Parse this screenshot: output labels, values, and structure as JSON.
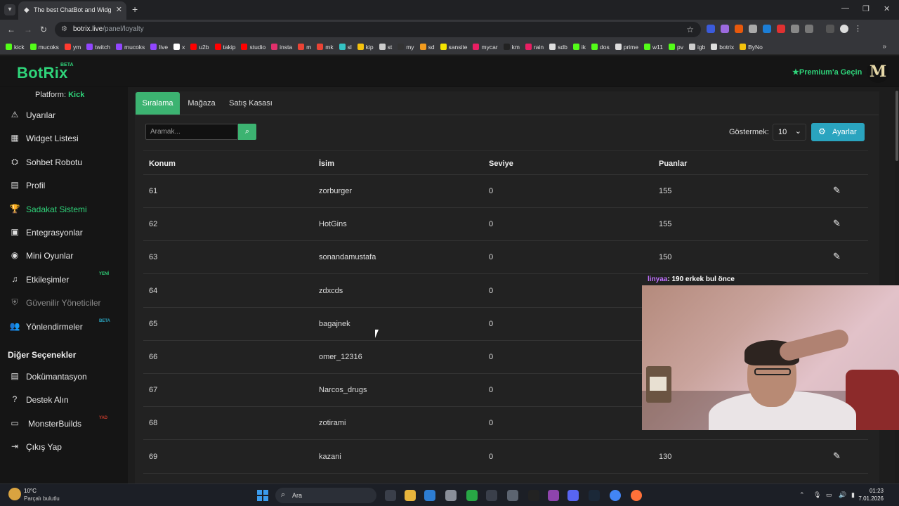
{
  "browser": {
    "tab_title": "The best ChatBot and Widgets",
    "url_host": "botrix.live",
    "url_path": "/panel/loyalty",
    "bookmarks": [
      {
        "label": "kick",
        "color": "#53fc18"
      },
      {
        "label": "mucoks",
        "color": "#53fc18"
      },
      {
        "label": "ym",
        "color": "#ff3b30"
      },
      {
        "label": "twitch",
        "color": "#9146ff"
      },
      {
        "label": "mucoks",
        "color": "#9146ff"
      },
      {
        "label": "live",
        "color": "#9146ff"
      },
      {
        "label": "x",
        "color": "#ffffff"
      },
      {
        "label": "u2b",
        "color": "#ff0000"
      },
      {
        "label": "takip",
        "color": "#ff0000"
      },
      {
        "label": "studio",
        "color": "#ff0000"
      },
      {
        "label": "insta",
        "color": "#e1306c"
      },
      {
        "label": "m",
        "color": "#ea4335"
      },
      {
        "label": "mk",
        "color": "#ea4335"
      },
      {
        "label": "sl",
        "color": "#34c3c3"
      },
      {
        "label": "kip",
        "color": "#f4c20d"
      },
      {
        "label": "st",
        "color": "#cccccc"
      },
      {
        "label": "my",
        "color": "#333333"
      },
      {
        "label": "sd",
        "color": "#f29b1e"
      },
      {
        "label": "sansite",
        "color": "#f4e400"
      },
      {
        "label": "mycar",
        "color": "#e91e63"
      },
      {
        "label": "km",
        "color": "#222222"
      },
      {
        "label": "rain",
        "color": "#e91e63"
      },
      {
        "label": "sdb",
        "color": "#dddddd"
      },
      {
        "label": "ik",
        "color": "#53fc18"
      },
      {
        "label": "dos",
        "color": "#53fc18"
      },
      {
        "label": "prime",
        "color": "#dddddd"
      },
      {
        "label": "w11",
        "color": "#53fc18"
      },
      {
        "label": "pv",
        "color": "#53fc18"
      },
      {
        "label": "igb",
        "color": "#cccccc"
      },
      {
        "label": "botrix",
        "color": "#dddddd"
      },
      {
        "label": "ByNo",
        "color": "#f4c20d"
      }
    ]
  },
  "app": {
    "logo": "BotRix",
    "logo_badge": "BETA",
    "premium_label": "Premium'a Geçin",
    "avatar_letter": "M"
  },
  "sidebar": {
    "platform_label": "Platform:",
    "platform_value": "Kick",
    "items": [
      {
        "label": "Uyarılar",
        "icon": "warning-icon"
      },
      {
        "label": "Widget Listesi",
        "icon": "grid-icon"
      },
      {
        "label": "Sohbet Robotu",
        "icon": "robot-icon"
      },
      {
        "label": "Profil",
        "icon": "id-card-icon"
      },
      {
        "label": "Sadakat Sistemi",
        "icon": "trophy-icon"
      },
      {
        "label": "Entegrasyonlar",
        "icon": "plug-icon"
      },
      {
        "label": "Mini Oyunlar",
        "icon": "gamepad-icon"
      },
      {
        "label": "Etkileşimler",
        "icon": "music-icon",
        "badge": "YENİ",
        "badge_color": "#2fd47a"
      },
      {
        "label": "Güvenilir Yöneticiler",
        "icon": "shield-icon"
      },
      {
        "label": "Yönlendirmeler",
        "icon": "users-icon",
        "badge": "BETA",
        "badge_color": "#2aa4bf"
      }
    ],
    "section_title": "Diğer Seçenekler",
    "other_items": [
      {
        "label": "Dokümantasyon",
        "icon": "document-icon"
      },
      {
        "label": "Destek Alın",
        "icon": "help-icon"
      },
      {
        "label": "MonsterBuilds",
        "icon": "laptop-icon",
        "badge": "YAD",
        "badge_color": "#c0392b"
      },
      {
        "label": "Çıkış Yap",
        "icon": "logout-icon"
      }
    ]
  },
  "main": {
    "tabs": [
      "Sıralama",
      "Mağaza",
      "Satış Kasası"
    ],
    "search_placeholder": "Aramak...",
    "show_label": "Göstermek:",
    "show_value": "10",
    "settings_label": "Ayarlar",
    "columns": [
      "Konum",
      "İsim",
      "Seviye",
      "Puanlar"
    ],
    "rows": [
      {
        "position": "61",
        "name": "zorburger",
        "level": "0",
        "points": "155"
      },
      {
        "position": "62",
        "name": "HotGins",
        "level": "0",
        "points": "155"
      },
      {
        "position": "63",
        "name": "sonandamustafa",
        "level": "0",
        "points": "150"
      },
      {
        "position": "64",
        "name": "zdxcds",
        "level": "0",
        "points": ""
      },
      {
        "position": "65",
        "name": "bagajnek",
        "level": "0",
        "points": ""
      },
      {
        "position": "66",
        "name": "omer_12316",
        "level": "0",
        "points": ""
      },
      {
        "position": "67",
        "name": "Narcos_drugs",
        "level": "0",
        "points": ""
      },
      {
        "position": "68",
        "name": "zotirami",
        "level": "0",
        "points": ""
      },
      {
        "position": "69",
        "name": "kazani",
        "level": "0",
        "points": "130"
      }
    ]
  },
  "overlay": {
    "chat_user": "linyaa",
    "chat_text": ": 190 erkek bul önce"
  },
  "taskbar": {
    "temperature": "10°C",
    "weather": "Parçalı bulutlu",
    "search_label": "Ara",
    "time": "01:23",
    "date": "7.01.2026"
  }
}
